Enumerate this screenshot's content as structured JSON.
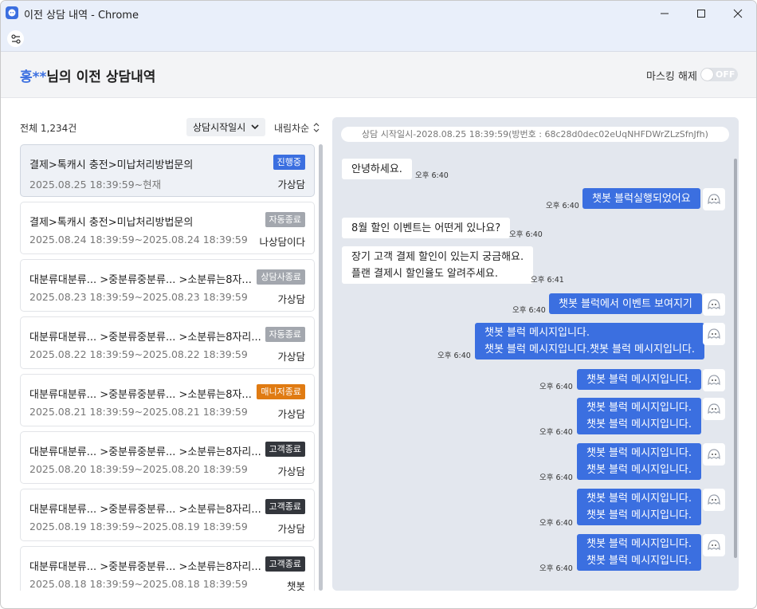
{
  "window": {
    "title": "이전 상담 내역 - Chrome"
  },
  "header": {
    "customer_name": "홍**",
    "title_suffix": "님의 이전 상담내역",
    "masking_label": "마스킹 해제",
    "masking_toggle": "OFF"
  },
  "list_controls": {
    "total": "전체 1,234건",
    "sort_field": "상담시작일시",
    "sort_order": "내림차순"
  },
  "consultations": [
    {
      "path": "결제>톡캐시 충전>미납처리방법문의",
      "status": "진행중",
      "status_color": "#3b6fe0",
      "date": "2025.08.25 18:39:59~현재",
      "agent": "가상담"
    },
    {
      "path": "결제>톡캐시 충전>미납처리방법문의",
      "status": "자동종료",
      "status_color": "#a3a7ae",
      "date": "2025.08.24 18:39:59~2025.08.24 18:39:59",
      "agent": "나상담이다"
    },
    {
      "path": "대분류대분류...  >중분류중분류...  >소분류는8자...",
      "status": "상담사종료",
      "status_color": "#a3a7ae",
      "date": "2025.08.23 18:39:59~2025.08.23 18:39:59",
      "agent": "가상담"
    },
    {
      "path": "대분류대분류...  >중분류중분류...  >소분류는8자리...",
      "status": "자동종료",
      "status_color": "#a3a7ae",
      "date": "2025.08.22 18:39:59~2025.08.22 18:39:59",
      "agent": "가상담"
    },
    {
      "path": "대분류대분류...  >중분류중분류...  >소분류는8자...",
      "status": "매니저종료",
      "status_color": "#e07b12",
      "date": "2025.08.21 18:39:59~2025.08.21 18:39:59",
      "agent": "가상담"
    },
    {
      "path": "대분류대분류...  >중분류중분류...  >소분류는8자리...",
      "status": "고객종료",
      "status_color": "#33363c",
      "date": "2025.08.20 18:39:59~2025.08.20 18:39:59",
      "agent": "가상담"
    },
    {
      "path": "대분류대분류...  >중분류중분류...  >소분류는8자리...",
      "status": "고객종료",
      "status_color": "#33363c",
      "date": "2025.08.19 18:39:59~2025.08.19 18:39:59",
      "agent": "가상담"
    },
    {
      "path": "대분류대분류...  >중분류중분류...  >소분류는8자리...",
      "status": "고객종료",
      "status_color": "#33363c",
      "date": "2025.08.18 18:39:59~2025.08.18 18:39:59",
      "agent": "챗봇"
    }
  ],
  "chat": {
    "header": "상담 시작일시-2028.08.25 18:39:59(방번호 : 68c28d0dec02eUqNHFDWrZLzSfnJfh)",
    "messages": [
      {
        "from": "user",
        "text": "안녕하세요.",
        "time": "오후 6:40"
      },
      {
        "from": "bot",
        "text": "챗봇 블럭실행되었어요",
        "time": "오후 6:40"
      },
      {
        "from": "user",
        "text": "8월 할인 이벤트는 어떤게 있나요?",
        "time": "오후 6:40"
      },
      {
        "from": "user",
        "text": "장기 고객 결제 할인이 있는지 궁금해요.",
        "text2": "플랜 결제시 할인율도 알려주세요.",
        "time": "오후 6:41"
      },
      {
        "from": "bot",
        "text": "챗봇 블럭에서 이벤트 보여지기",
        "time": "오후 6:40"
      },
      {
        "from": "bot",
        "text": "챗봇 블럭 메시지입니다.",
        "text2": "챗봇 블럭 메시지입니다.챗봇 블럭 메시지입니다.",
        "time": "오후 6:40"
      },
      {
        "from": "bot",
        "text": "챗봇 블럭 메시지입니다.",
        "time": "오후 6:40"
      },
      {
        "from": "bot",
        "text": "챗봇 블럭 메시지입니다.",
        "text2": "챗봇 블럭 메시지입니다.",
        "time": "오후 6:40"
      },
      {
        "from": "bot",
        "text": "챗봇 블럭 메시지입니다.",
        "text2": "챗봇 블럭 메시지입니다.",
        "time": "오후 6:40"
      },
      {
        "from": "bot",
        "text": "챗봇 블럭 메시지입니다.",
        "text2": "챗봇 블럭 메시지입니다.",
        "time": "오후 6:40"
      },
      {
        "from": "bot",
        "text": "챗봇 블럭 메시지입니다.",
        "text2": "챗봇 블럭 메시지입니다.",
        "time": "오후 6:40"
      }
    ]
  },
  "icons": {
    "app": "chat-bubble-icon",
    "toolbar": "settings-sliders-icon",
    "bot_avatar": "bot-face-icon"
  },
  "colors": {
    "accent": "#3b6fe0",
    "chat_bg": "#e3e7ee"
  }
}
